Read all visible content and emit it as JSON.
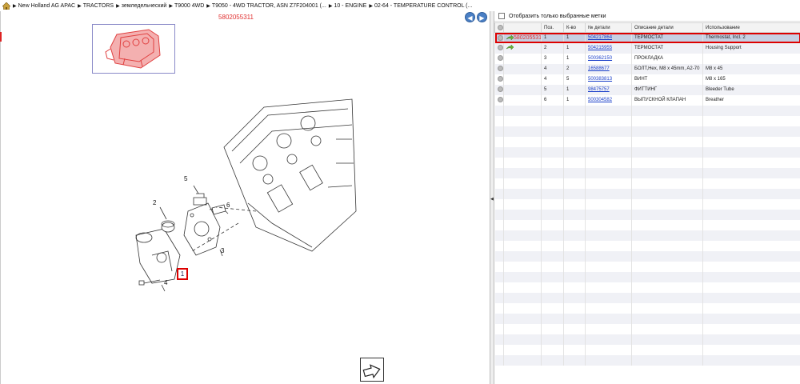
{
  "breadcrumb": [
    "New Holland AG APAC",
    "TRACTORS",
    "земледельческий",
    "T9000 4WD",
    "T9050 - 4WD TRACTOR, ASN Z7F204001 (...",
    "10 - ENGINE",
    "02-64 - TEMPERATURE CONTROL (..."
  ],
  "left": {
    "part_number": "5802055311",
    "callouts": [
      "1",
      "2",
      "3",
      "4",
      "5",
      "6"
    ],
    "nav_back_icon": "arrow-left-circle-icon",
    "nav_forward_icon": "arrow-right-circle-icon",
    "export_icon": "export-arrow-icon"
  },
  "right": {
    "filter_label": "Отобразить только выбранные метки",
    "columns": [
      "",
      "",
      "Поз.",
      "К-во",
      "№ детали",
      "Описание детали",
      "Использование"
    ],
    "rows": [
      {
        "pos": "1",
        "qty": "1",
        "part": "504217864",
        "desc": "ТЕРМОСТАТ",
        "usage": "Thermostat, Incl. 2",
        "marker": "5802055311",
        "selected": true
      },
      {
        "pos": "2",
        "qty": "1",
        "part": "504215955",
        "desc": "ТЕРМОСТАТ",
        "usage": "Housing Support",
        "marker": "",
        "selected": false
      },
      {
        "pos": "3",
        "qty": "1",
        "part": "500362150",
        "desc": "ПРОКЛАДКА",
        "usage": "",
        "marker": "",
        "selected": false
      },
      {
        "pos": "4",
        "qty": "2",
        "part": "16588677",
        "desc": "БОЛТ,Hex, M8 x 45mm, A2-70",
        "usage": "M8 x 45",
        "marker": "",
        "selected": false
      },
      {
        "pos": "4",
        "qty": "5",
        "part": "500383813",
        "desc": "ВИНТ",
        "usage": "M8 x 165",
        "marker": "",
        "selected": false
      },
      {
        "pos": "5",
        "qty": "1",
        "part": "98475757",
        "desc": "ФИТТИНГ",
        "usage": "Bleeder Tube",
        "marker": "",
        "selected": false
      },
      {
        "pos": "6",
        "qty": "1",
        "part": "500304582",
        "desc": "ВЫПУСКНОЙ КЛАПАН",
        "usage": "Breather",
        "marker": "",
        "selected": false
      }
    ]
  },
  "colors": {
    "accent_red": "#e03030",
    "link_blue": "#1a3fc9",
    "selected_row": "#c6d0e3"
  }
}
